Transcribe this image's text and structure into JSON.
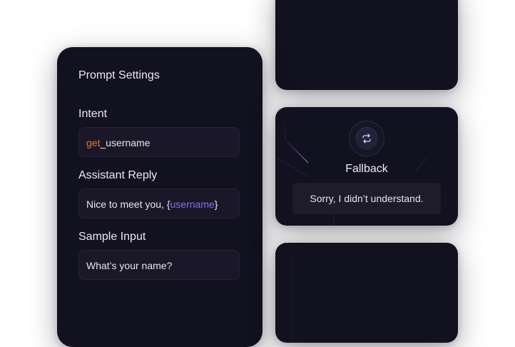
{
  "prompt_settings": {
    "title": "Prompt Settings",
    "intent": {
      "label": "Intent",
      "value_prefix": "get",
      "value_suffix": "_username"
    },
    "assistant_reply": {
      "label": "Assistant Reply",
      "value_text": "Nice to meet you, {",
      "variable": "username",
      "value_close": "}"
    },
    "sample_input": {
      "label": "Sample Input",
      "value": "What’s your name?"
    }
  },
  "fallback": {
    "title": "Fallback",
    "icon": "repeat-icon",
    "message": "Sorry, I didn’t understand."
  },
  "colors": {
    "card_background": "#12111f",
    "field_background": "#1a1828",
    "accent_orange": "#e0753a",
    "accent_purple": "#8b6cf0"
  }
}
